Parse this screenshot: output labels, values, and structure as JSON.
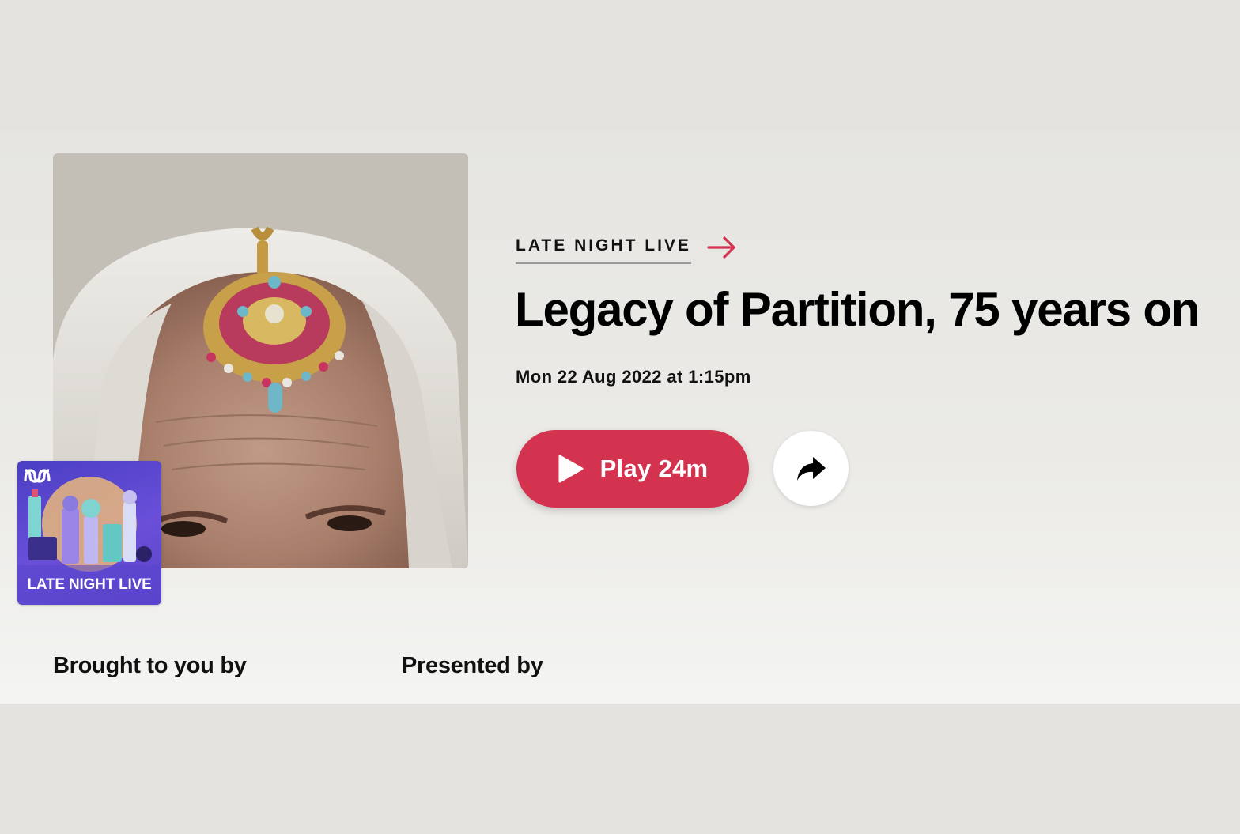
{
  "program": {
    "link_label": "LATE NIGHT LIVE",
    "thumbnail_title": "LATE NIGHT LIVE",
    "arrow_icon": "arrow-right-icon"
  },
  "episode": {
    "title": "Legacy of Partition, 75 years on",
    "broadcast": "Mon 22 Aug 2022 at 1:15pm",
    "image_subject": "elderly woman wearing a jewelled forehead ornament"
  },
  "actions": {
    "play_label": "Play 24m",
    "play_icon": "play-icon",
    "share_icon": "share-icon"
  },
  "credits": {
    "brought_to_you_by": "Brought to you by",
    "presented_by": "Presented by"
  },
  "colors": {
    "accent": "#d3334f",
    "background": "#e4e3df",
    "thumbnail": "#5b43c8"
  }
}
